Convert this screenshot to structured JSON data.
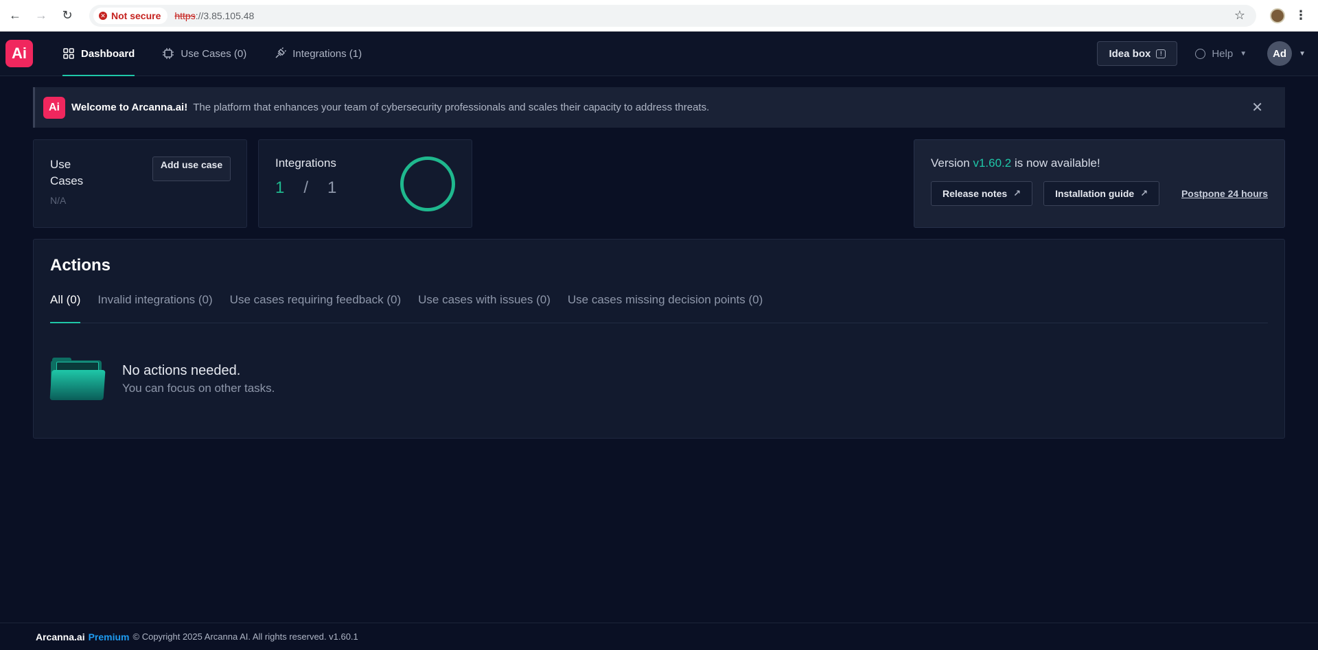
{
  "browser": {
    "security_label": "Not secure",
    "url_proto": "https",
    "url_rest": "://3.85.105.48"
  },
  "header": {
    "logo_text": "Ai",
    "tabs": [
      {
        "label": "Dashboard",
        "active": true
      },
      {
        "label": "Use Cases (0)",
        "active": false
      },
      {
        "label": "Integrations (1)",
        "active": false
      }
    ],
    "idea_box_label": "Idea box",
    "help_label": "Help",
    "avatar_initials": "Ad"
  },
  "banner": {
    "logo_text": "Ai",
    "title": "Welcome to Arcanna.ai!",
    "description": "The platform that enhances your team of cybersecurity professionals and scales their capacity to address threats."
  },
  "use_cases_card": {
    "label": "Use Cases",
    "value": "N/A",
    "add_button": "Add use case"
  },
  "integrations_card": {
    "label": "Integrations",
    "active": "1",
    "separator": "/",
    "total": "1"
  },
  "version_card": {
    "prefix": "Version",
    "version": "v1.60.2",
    "suffix": "is now available!",
    "release_notes": "Release notes",
    "installation_guide": "Installation guide",
    "postpone": "Postpone 24 hours"
  },
  "actions": {
    "title": "Actions",
    "tabs": [
      {
        "label": "All (0)",
        "active": true
      },
      {
        "label": "Invalid integrations (0)",
        "active": false
      },
      {
        "label": "Use cases requiring feedback (0)",
        "active": false
      },
      {
        "label": "Use cases with issues (0)",
        "active": false
      },
      {
        "label": "Use cases missing decision points (0)",
        "active": false
      }
    ],
    "empty_title": "No actions needed.",
    "empty_subtitle": "You can focus on other tasks."
  },
  "footer": {
    "brand": "Arcanna.ai",
    "tier": "Premium",
    "copyright": "© Copyright 2025 Arcanna AI. All rights reserved. v1.60.1"
  },
  "colors": {
    "accent": "#1fc7a8",
    "brand": "#f0275e",
    "background": "#0a1024"
  }
}
